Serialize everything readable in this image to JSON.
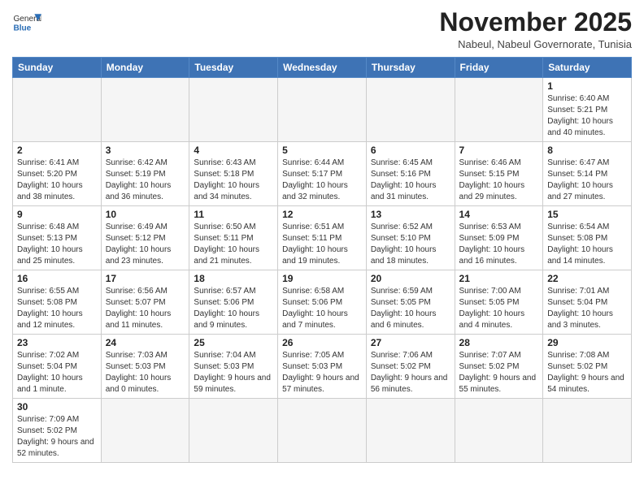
{
  "logo": {
    "general": "General",
    "blue": "Blue"
  },
  "header": {
    "month_year": "November 2025",
    "location": "Nabeul, Nabeul Governorate, Tunisia"
  },
  "weekdays": [
    "Sunday",
    "Monday",
    "Tuesday",
    "Wednesday",
    "Thursday",
    "Friday",
    "Saturday"
  ],
  "weeks": [
    [
      {
        "day": "",
        "info": ""
      },
      {
        "day": "",
        "info": ""
      },
      {
        "day": "",
        "info": ""
      },
      {
        "day": "",
        "info": ""
      },
      {
        "day": "",
        "info": ""
      },
      {
        "day": "",
        "info": ""
      },
      {
        "day": "1",
        "info": "Sunrise: 6:40 AM\nSunset: 5:21 PM\nDaylight: 10 hours and 40 minutes."
      }
    ],
    [
      {
        "day": "2",
        "info": "Sunrise: 6:41 AM\nSunset: 5:20 PM\nDaylight: 10 hours and 38 minutes."
      },
      {
        "day": "3",
        "info": "Sunrise: 6:42 AM\nSunset: 5:19 PM\nDaylight: 10 hours and 36 minutes."
      },
      {
        "day": "4",
        "info": "Sunrise: 6:43 AM\nSunset: 5:18 PM\nDaylight: 10 hours and 34 minutes."
      },
      {
        "day": "5",
        "info": "Sunrise: 6:44 AM\nSunset: 5:17 PM\nDaylight: 10 hours and 32 minutes."
      },
      {
        "day": "6",
        "info": "Sunrise: 6:45 AM\nSunset: 5:16 PM\nDaylight: 10 hours and 31 minutes."
      },
      {
        "day": "7",
        "info": "Sunrise: 6:46 AM\nSunset: 5:15 PM\nDaylight: 10 hours and 29 minutes."
      },
      {
        "day": "8",
        "info": "Sunrise: 6:47 AM\nSunset: 5:14 PM\nDaylight: 10 hours and 27 minutes."
      }
    ],
    [
      {
        "day": "9",
        "info": "Sunrise: 6:48 AM\nSunset: 5:13 PM\nDaylight: 10 hours and 25 minutes."
      },
      {
        "day": "10",
        "info": "Sunrise: 6:49 AM\nSunset: 5:12 PM\nDaylight: 10 hours and 23 minutes."
      },
      {
        "day": "11",
        "info": "Sunrise: 6:50 AM\nSunset: 5:11 PM\nDaylight: 10 hours and 21 minutes."
      },
      {
        "day": "12",
        "info": "Sunrise: 6:51 AM\nSunset: 5:11 PM\nDaylight: 10 hours and 19 minutes."
      },
      {
        "day": "13",
        "info": "Sunrise: 6:52 AM\nSunset: 5:10 PM\nDaylight: 10 hours and 18 minutes."
      },
      {
        "day": "14",
        "info": "Sunrise: 6:53 AM\nSunset: 5:09 PM\nDaylight: 10 hours and 16 minutes."
      },
      {
        "day": "15",
        "info": "Sunrise: 6:54 AM\nSunset: 5:08 PM\nDaylight: 10 hours and 14 minutes."
      }
    ],
    [
      {
        "day": "16",
        "info": "Sunrise: 6:55 AM\nSunset: 5:08 PM\nDaylight: 10 hours and 12 minutes."
      },
      {
        "day": "17",
        "info": "Sunrise: 6:56 AM\nSunset: 5:07 PM\nDaylight: 10 hours and 11 minutes."
      },
      {
        "day": "18",
        "info": "Sunrise: 6:57 AM\nSunset: 5:06 PM\nDaylight: 10 hours and 9 minutes."
      },
      {
        "day": "19",
        "info": "Sunrise: 6:58 AM\nSunset: 5:06 PM\nDaylight: 10 hours and 7 minutes."
      },
      {
        "day": "20",
        "info": "Sunrise: 6:59 AM\nSunset: 5:05 PM\nDaylight: 10 hours and 6 minutes."
      },
      {
        "day": "21",
        "info": "Sunrise: 7:00 AM\nSunset: 5:05 PM\nDaylight: 10 hours and 4 minutes."
      },
      {
        "day": "22",
        "info": "Sunrise: 7:01 AM\nSunset: 5:04 PM\nDaylight: 10 hours and 3 minutes."
      }
    ],
    [
      {
        "day": "23",
        "info": "Sunrise: 7:02 AM\nSunset: 5:04 PM\nDaylight: 10 hours and 1 minute."
      },
      {
        "day": "24",
        "info": "Sunrise: 7:03 AM\nSunset: 5:03 PM\nDaylight: 10 hours and 0 minutes."
      },
      {
        "day": "25",
        "info": "Sunrise: 7:04 AM\nSunset: 5:03 PM\nDaylight: 9 hours and 59 minutes."
      },
      {
        "day": "26",
        "info": "Sunrise: 7:05 AM\nSunset: 5:03 PM\nDaylight: 9 hours and 57 minutes."
      },
      {
        "day": "27",
        "info": "Sunrise: 7:06 AM\nSunset: 5:02 PM\nDaylight: 9 hours and 56 minutes."
      },
      {
        "day": "28",
        "info": "Sunrise: 7:07 AM\nSunset: 5:02 PM\nDaylight: 9 hours and 55 minutes."
      },
      {
        "day": "29",
        "info": "Sunrise: 7:08 AM\nSunset: 5:02 PM\nDaylight: 9 hours and 54 minutes."
      }
    ],
    [
      {
        "day": "30",
        "info": "Sunrise: 7:09 AM\nSunset: 5:02 PM\nDaylight: 9 hours and 52 minutes."
      },
      {
        "day": "",
        "info": ""
      },
      {
        "day": "",
        "info": ""
      },
      {
        "day": "",
        "info": ""
      },
      {
        "day": "",
        "info": ""
      },
      {
        "day": "",
        "info": ""
      },
      {
        "day": "",
        "info": ""
      }
    ]
  ]
}
